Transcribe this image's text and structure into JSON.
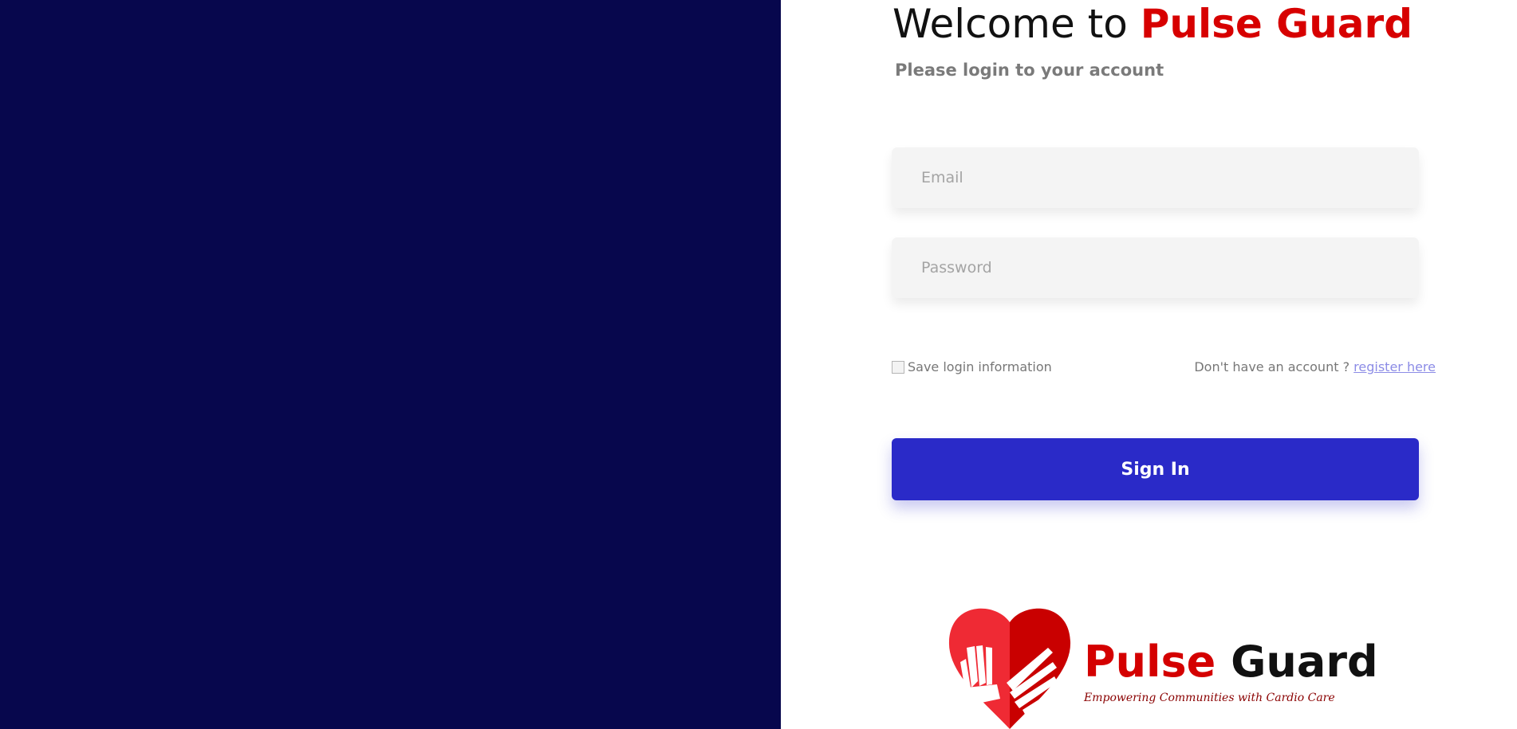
{
  "header": {
    "title_prefix": "Welcome to ",
    "title_brand": "Pulse Guard",
    "subtitle": "Please login to your account"
  },
  "form": {
    "email_placeholder": "Email",
    "password_placeholder": "Password",
    "remember_label": "Save login information",
    "register_prompt": "Don't have an account ? ",
    "register_link": "register here",
    "signin_label": "Sign In"
  },
  "logo": {
    "name_red": "Pulse",
    "name_black": "Guard",
    "tagline": "Empowering Communities with Cardio Care"
  },
  "colors": {
    "left_panel": "#07074d",
    "brand_red": "#d70000",
    "button": "#2a2ac8"
  }
}
